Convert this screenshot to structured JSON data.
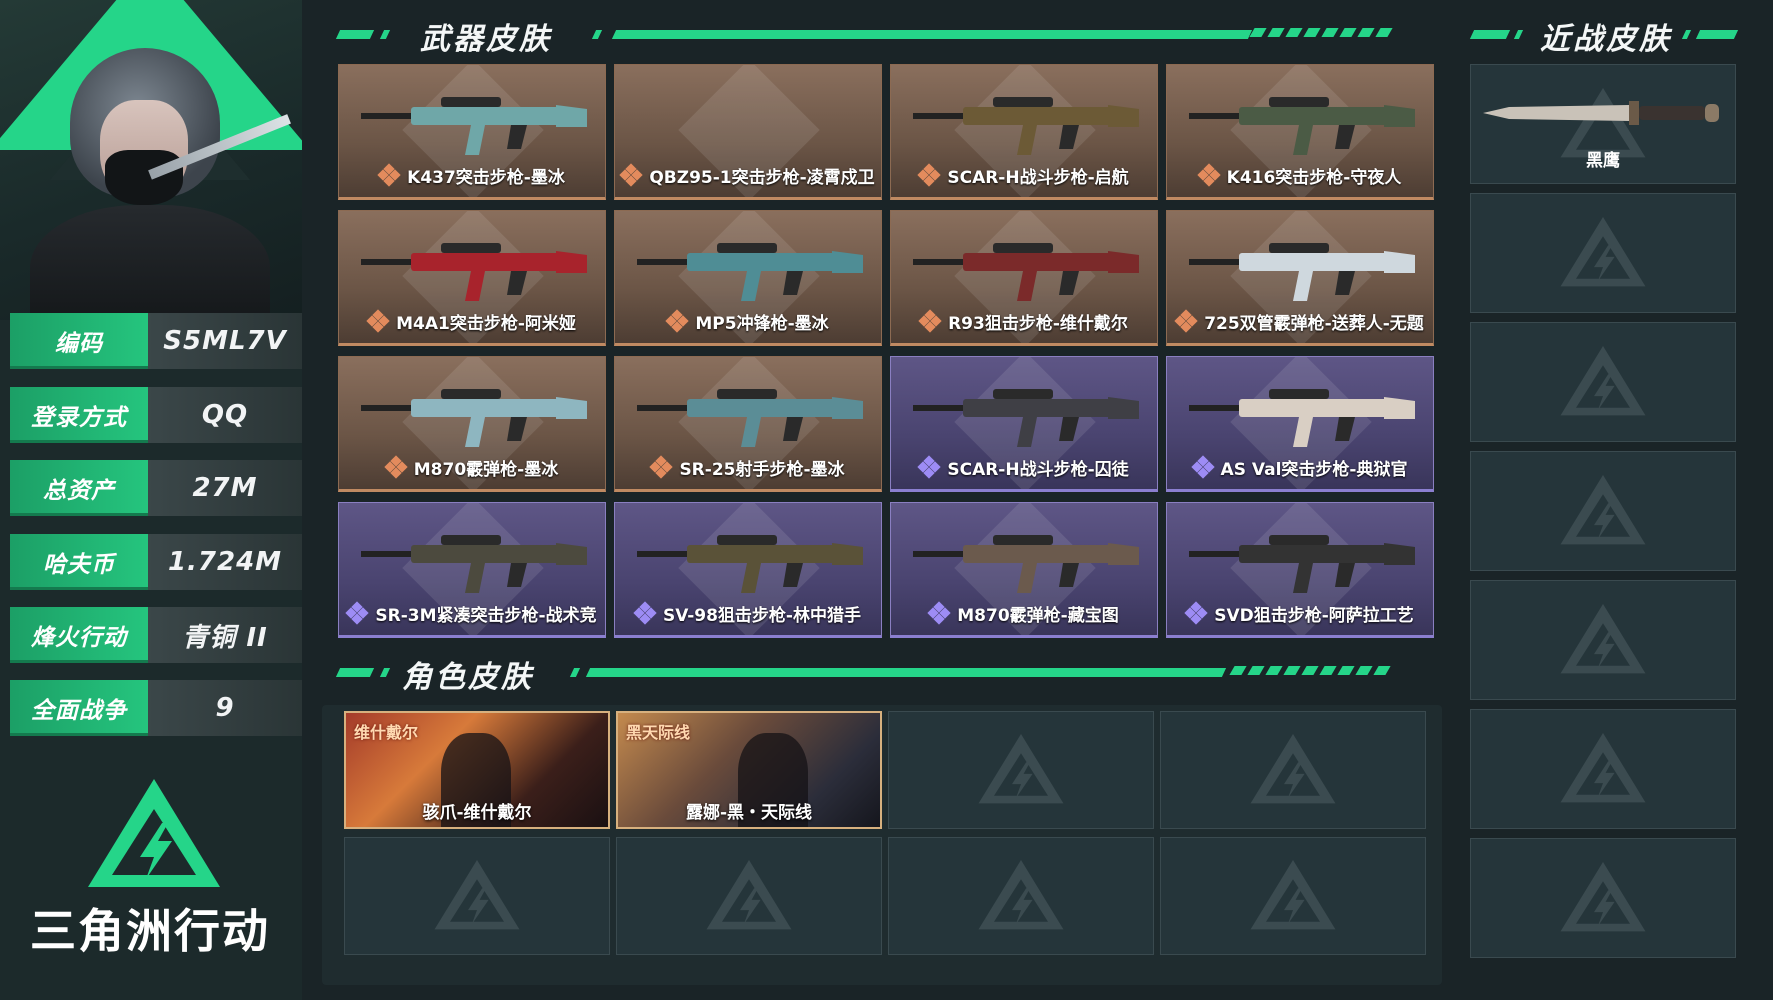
{
  "profile": {
    "rows": [
      {
        "label": "编码",
        "value": "S5ML7V"
      },
      {
        "label": "登录方式",
        "value": "QQ"
      },
      {
        "label": "总资产",
        "value": "27M"
      },
      {
        "label": "哈夫币",
        "value": "1.724M"
      },
      {
        "label": "烽火行动",
        "value": "青铜 II"
      },
      {
        "label": "全面战争",
        "value": "9"
      }
    ],
    "game_title": "三角洲行动"
  },
  "sections": {
    "weapons_title": "武器皮肤",
    "roles_title": "角色皮肤",
    "melee_title": "近战皮肤"
  },
  "weapons": [
    {
      "name": "K437突击步枪-墨冰",
      "rarity": "gold"
    },
    {
      "name": "QBZ95-1突击步枪-凌霄戍卫",
      "rarity": "gold"
    },
    {
      "name": "SCAR-H战斗步枪-启航",
      "rarity": "gold"
    },
    {
      "name": "K416突击步枪-守夜人",
      "rarity": "gold"
    },
    {
      "name": "M4A1突击步枪-阿米娅",
      "rarity": "gold"
    },
    {
      "name": "MP5冲锋枪-墨冰",
      "rarity": "gold"
    },
    {
      "name": "R93狙击步枪-维什戴尔",
      "rarity": "gold"
    },
    {
      "name": "725双管霰弹枪-送葬人-无题",
      "rarity": "gold"
    },
    {
      "name": "M870霰弹枪-墨冰",
      "rarity": "gold"
    },
    {
      "name": "SR-25射手步枪-墨冰",
      "rarity": "gold"
    },
    {
      "name": "SCAR-H战斗步枪-囚徒",
      "rarity": "purple"
    },
    {
      "name": "AS Val突击步枪-典狱官",
      "rarity": "purple"
    },
    {
      "name": "SR-3M紧凑突击步枪-战术竞",
      "rarity": "purple"
    },
    {
      "name": "SV-98狙击步枪-林中猎手",
      "rarity": "purple"
    },
    {
      "name": "M870霰弹枪-藏宝图",
      "rarity": "purple"
    },
    {
      "name": "SVD狙击步枪-阿萨拉工艺",
      "rarity": "purple"
    }
  ],
  "roles": [
    {
      "name": "骇爪-维什戴尔",
      "tag": "维什戴尔"
    },
    {
      "name": "露娜-黑・天际线",
      "tag": "黑天际线"
    }
  ],
  "melee": [
    {
      "name": "黑鹰"
    }
  ],
  "colors": {
    "accent": "#25d589",
    "gold_border": "#c08a62",
    "purple_border": "#8b7fd0",
    "background": "#1a2427"
  }
}
